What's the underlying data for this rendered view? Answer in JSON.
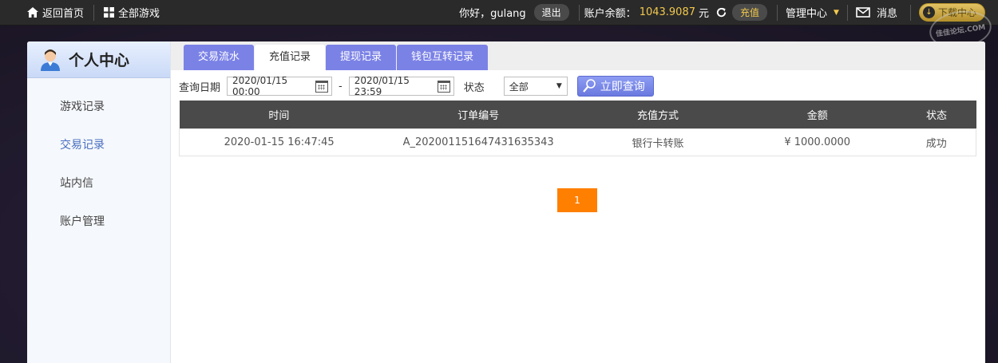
{
  "topbar": {
    "home_label": "返回首页",
    "games_label": "全部游戏",
    "greeting": "你好，gulang",
    "logout_label": "退出",
    "balance_label": "账户余额：",
    "balance_value": "1043.9087",
    "currency": "元",
    "recharge_label": "充值",
    "admin_label": "管理中心",
    "message_label": "消息",
    "download_label": "下载中心"
  },
  "watermark_text": "佳佳论坛.COM",
  "sidebar": {
    "title": "个人中心",
    "items": [
      {
        "label": "游戏记录"
      },
      {
        "label": "交易记录"
      },
      {
        "label": "站内信"
      },
      {
        "label": "账户管理"
      }
    ]
  },
  "tabs": [
    {
      "label": "交易流水"
    },
    {
      "label": "充值记录"
    },
    {
      "label": "提现记录"
    },
    {
      "label": "钱包互转记录"
    }
  ],
  "filter": {
    "date_label": "查询日期",
    "date_from": "2020/01/15 00:00",
    "separator": "-",
    "date_to": "2020/01/15 23:59",
    "status_label": "状态",
    "status_value": "全部",
    "search_label": "立即查询"
  },
  "table": {
    "headers": [
      "时间",
      "订单编号",
      "充值方式",
      "金额",
      "状态"
    ],
    "rows": [
      [
        "2020-01-15 16:47:45",
        "A_20200115164743163534​3",
        "银行卡转账",
        "¥ 1000.0000",
        "成功"
      ]
    ]
  },
  "pagination": {
    "current": "1"
  },
  "colors": {
    "tab_accent": "#7b82e6",
    "balance": "#f2c94c",
    "pager": "#ff7f00",
    "table_header": "#4a4a4a"
  }
}
